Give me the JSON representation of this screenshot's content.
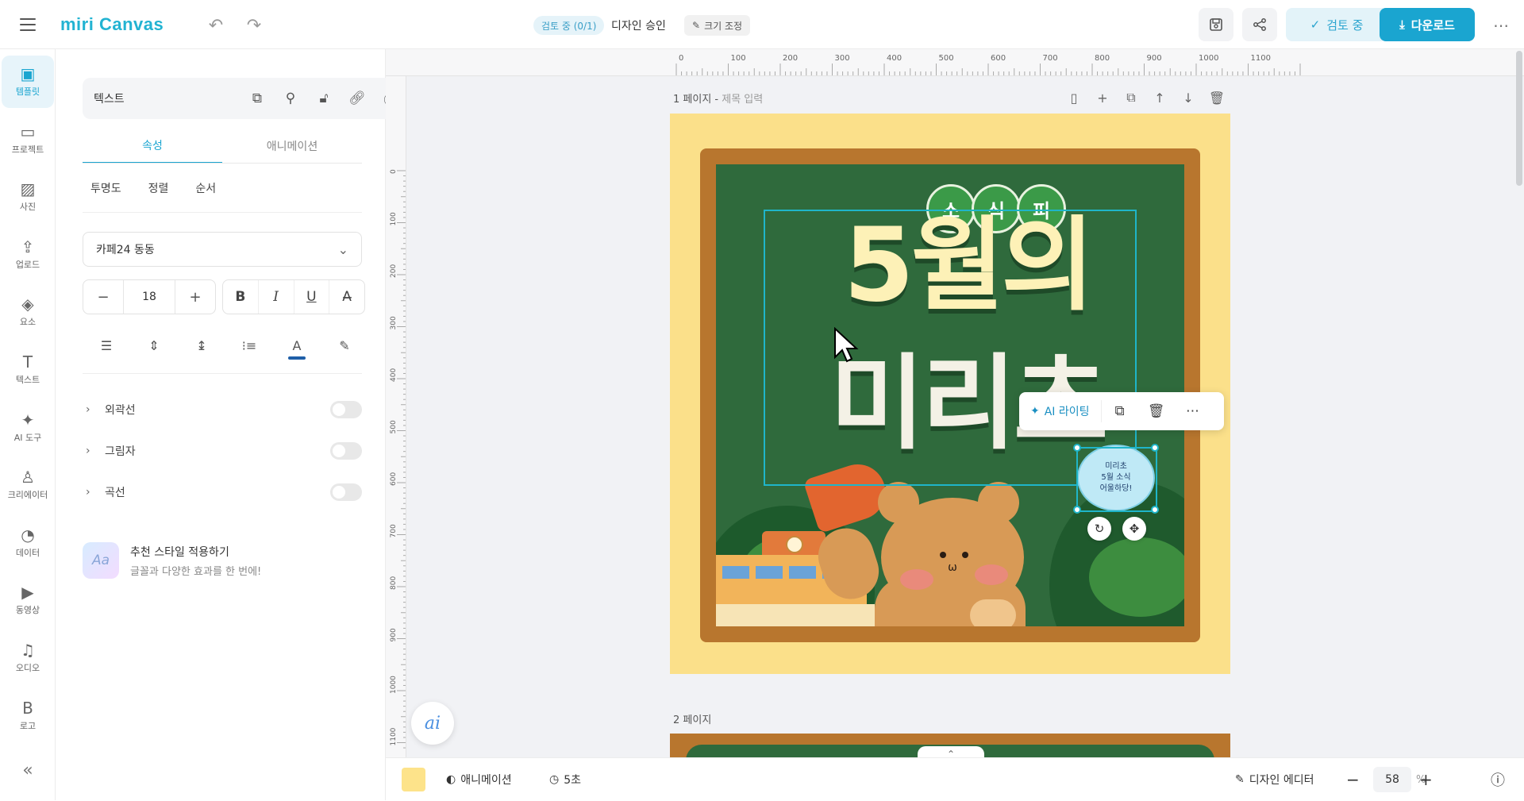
{
  "app": {
    "logo": "miri Canvas",
    "review_chip": "검토 중 (0/1)",
    "approve": "디자인 승인",
    "resize": "크기 조정",
    "review_button": "검토 중",
    "download_button": "다운로드"
  },
  "sidebar": {
    "items": [
      {
        "label": "템플릿",
        "icon": "template-icon",
        "glyph": "▣"
      },
      {
        "label": "프로젝트",
        "icon": "folder-icon",
        "glyph": "▭"
      },
      {
        "label": "사진",
        "icon": "photo-icon",
        "glyph": "▨"
      },
      {
        "label": "업로드",
        "icon": "upload-icon",
        "glyph": "⇪"
      },
      {
        "label": "요소",
        "icon": "elements-icon",
        "glyph": "◈"
      },
      {
        "label": "텍스트",
        "icon": "text-icon",
        "glyph": "T"
      },
      {
        "label": "AI 도구",
        "icon": "ai-sparkle-icon",
        "glyph": "✦"
      },
      {
        "label": "크리에이터",
        "icon": "creator-icon",
        "glyph": "♙"
      },
      {
        "label": "데이터",
        "icon": "data-chart-icon",
        "glyph": "◔"
      },
      {
        "label": "동영상",
        "icon": "video-icon",
        "glyph": "▶"
      },
      {
        "label": "오디오",
        "icon": "audio-icon",
        "glyph": "♫"
      },
      {
        "label": "로고",
        "icon": "logo-icon",
        "glyph": "B"
      }
    ]
  },
  "panel": {
    "title": "텍스트",
    "tabs": [
      "속성",
      "애니메이션"
    ],
    "subtabs": [
      "투명도",
      "정렬",
      "순서"
    ],
    "font": "카페24 동동",
    "font_size": "18",
    "toggles": [
      "외곽선",
      "그림자",
      "곡선"
    ],
    "recommend_title": "추천 스타일 적용하기",
    "recommend_sub": "글꼴과 다양한 효과를 한 번에!",
    "recommend_thumb": "Aa"
  },
  "canvas": {
    "ruler_top": [
      "0",
      "100",
      "200",
      "300",
      "400",
      "500",
      "600",
      "700",
      "800",
      "900",
      "1000",
      "1100"
    ],
    "ruler_left": [
      "0",
      "100",
      "200",
      "300",
      "400",
      "500",
      "600",
      "700",
      "800",
      "900",
      "1000",
      "1100"
    ],
    "page1_label": "1 페이지 - ",
    "page1_placeholder": "제목 입력",
    "page2_label": "2 페이지",
    "pill_chars": [
      "소",
      "식",
      "피"
    ],
    "headline1": "5월의",
    "headline2": "미리초",
    "bubble": [
      "미리초",
      "5월 소식",
      "어울하당!"
    ],
    "ai_writing": "AI 라이팅",
    "ai_fab": "ai"
  },
  "bottom": {
    "animation": "애니메이션",
    "duration": "5초",
    "editor": "디자인 에디터",
    "zoom": "58",
    "zoom_unit": "%"
  },
  "colors": {
    "accent": "#1aa5d0",
    "page_bg": "#fbe08a",
    "board": "#2f6a3c",
    "frame": "#b8762e"
  }
}
